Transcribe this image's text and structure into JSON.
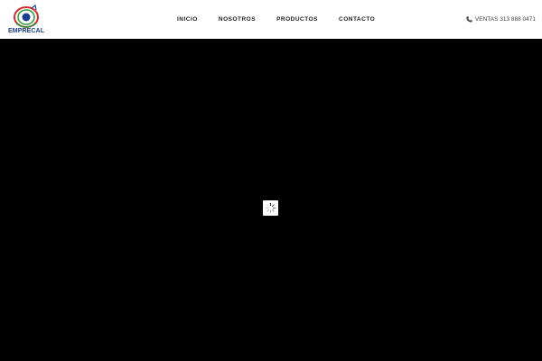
{
  "header": {
    "logo": {
      "text": "EMPRECAL",
      "icon": "globe-logo-icon"
    },
    "nav": [
      {
        "label": "INICIO"
      },
      {
        "label": "NOSOTROS"
      },
      {
        "label": "PRODUCTOS"
      },
      {
        "label": "CONTACTO"
      }
    ],
    "contact": {
      "icon": "phone-icon",
      "text": "VENTAS 313 888 0471"
    }
  },
  "hero": {
    "loader_icon": "spinner-icon"
  },
  "colors": {
    "header_bg": "#ffffff",
    "hero_bg": "#000000",
    "brand_blue": "#1a3e8c",
    "brand_red": "#d42a2a",
    "brand_green": "#2e9a3e"
  }
}
